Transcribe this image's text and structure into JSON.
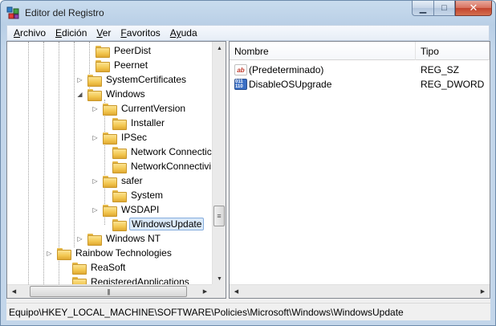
{
  "window": {
    "title": "Editor del Registro"
  },
  "menu": [
    {
      "label": "Archivo",
      "access": "A",
      "rest": "rchivo"
    },
    {
      "label": "Edición",
      "access": "E",
      "rest": "dición"
    },
    {
      "label": "Ver",
      "access": "V",
      "rest": "er"
    },
    {
      "label": "Favoritos",
      "access": "F",
      "rest": "avoritos"
    },
    {
      "label": "Ayuda",
      "access": "Ay",
      "rest": "uda"
    }
  ],
  "tree": {
    "items": [
      {
        "label": "PeerDist",
        "expander": ""
      },
      {
        "label": "Peernet",
        "expander": ""
      },
      {
        "label": "SystemCertificates",
        "expander": "▷"
      },
      {
        "label": "Windows",
        "expander": "◢"
      },
      {
        "label": "CurrentVersion",
        "expander": "▷"
      },
      {
        "label": "Installer",
        "expander": ""
      },
      {
        "label": "IPSec",
        "expander": "▷"
      },
      {
        "label": "Network Connectic",
        "expander": ""
      },
      {
        "label": "NetworkConnectivi",
        "expander": ""
      },
      {
        "label": "safer",
        "expander": "▷"
      },
      {
        "label": "System",
        "expander": ""
      },
      {
        "label": "WSDAPI",
        "expander": "▷"
      },
      {
        "label": "WindowsUpdate",
        "expander": "",
        "selected": true
      },
      {
        "label": "Windows NT",
        "expander": "▷"
      },
      {
        "label": "Rainbow Technologies",
        "expander": "▷"
      },
      {
        "label": "ReaSoft",
        "expander": ""
      },
      {
        "label": "RegisteredApplications",
        "expander": ""
      }
    ]
  },
  "values": {
    "columns": {
      "name": "Nombre",
      "type": "Tipo"
    },
    "rows": [
      {
        "name": "(Predeterminado)",
        "type": "REG_SZ",
        "icon": "string-value-icon",
        "glyph": "ab"
      },
      {
        "name": "DisableOSUpgrade",
        "type": "REG_DWORD",
        "icon": "binary-value-icon",
        "glyph": "011 110"
      }
    ]
  },
  "status": {
    "path": "Equipo\\HKEY_LOCAL_MACHINE\\SOFTWARE\\Policies\\Microsoft\\Windows\\WindowsUpdate"
  }
}
